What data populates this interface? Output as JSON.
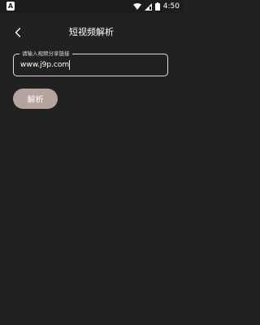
{
  "status_bar": {
    "app_badge": "A",
    "time": "4:50"
  },
  "header": {
    "title": "短视频解析"
  },
  "form": {
    "link_field": {
      "label": "请输入视频分享链接",
      "value": "www.j9p.com"
    },
    "parse_button_label": "解析"
  },
  "colors": {
    "background": "#212121",
    "field_border": "#e6dcd6",
    "button": "#b5a49e"
  }
}
